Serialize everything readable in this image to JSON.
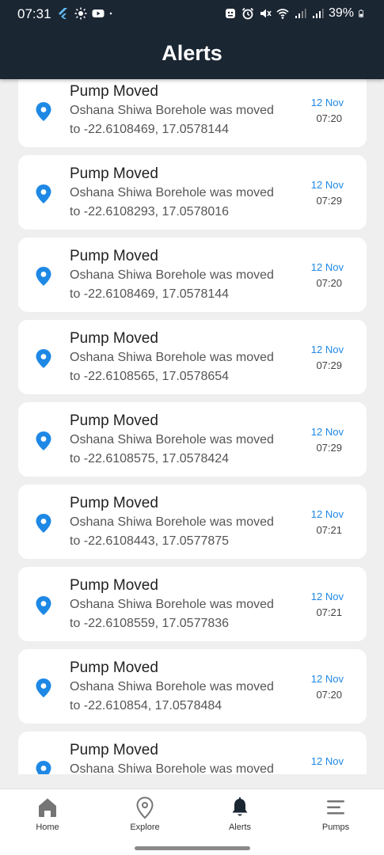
{
  "status_bar": {
    "time": "07:31",
    "battery": "39%"
  },
  "app_bar": {
    "title": "Alerts"
  },
  "alerts": [
    {
      "title": "Pump Moved",
      "line1": "Oshana Shiwa Borehole was moved",
      "line2": "to -22.6108469, 17.0578144",
      "date": "12 Nov",
      "time": "07:20"
    },
    {
      "title": "Pump Moved",
      "line1": "Oshana Shiwa Borehole was moved",
      "line2": "to -22.6108293, 17.0578016",
      "date": "12 Nov",
      "time": "07:29"
    },
    {
      "title": "Pump Moved",
      "line1": "Oshana Shiwa Borehole was moved",
      "line2": "to -22.6108469, 17.0578144",
      "date": "12 Nov",
      "time": "07:20"
    },
    {
      "title": "Pump Moved",
      "line1": "Oshana Shiwa Borehole was moved",
      "line2": "to -22.6108565, 17.0578654",
      "date": "12 Nov",
      "time": "07:29"
    },
    {
      "title": "Pump Moved",
      "line1": "Oshana Shiwa Borehole was moved",
      "line2": "to -22.6108575, 17.0578424",
      "date": "12 Nov",
      "time": "07:29"
    },
    {
      "title": "Pump Moved",
      "line1": "Oshana Shiwa Borehole was moved",
      "line2": "to -22.6108443, 17.0577875",
      "date": "12 Nov",
      "time": "07:21"
    },
    {
      "title": "Pump Moved",
      "line1": "Oshana Shiwa Borehole was moved",
      "line2": "to -22.6108559, 17.0577836",
      "date": "12 Nov",
      "time": "07:21"
    },
    {
      "title": "Pump Moved",
      "line1": "Oshana Shiwa Borehole was moved",
      "line2": "to -22.610854, 17.0578484",
      "date": "12 Nov",
      "time": "07:20"
    },
    {
      "title": "Pump Moved",
      "line1": "Oshana Shiwa Borehole was moved",
      "line2": "",
      "date": "12 Nov",
      "time": ""
    }
  ],
  "bottom_nav": {
    "items": [
      {
        "label": "Home",
        "icon": "home-icon"
      },
      {
        "label": "Explore",
        "icon": "location-pin-icon"
      },
      {
        "label": "Alerts",
        "icon": "bell-icon",
        "active": true
      },
      {
        "label": "Pumps",
        "icon": "menu-lines-icon"
      }
    ]
  },
  "colors": {
    "app_bar": "#1b2633",
    "accent": "#1e88e5",
    "background": "#efefef"
  }
}
